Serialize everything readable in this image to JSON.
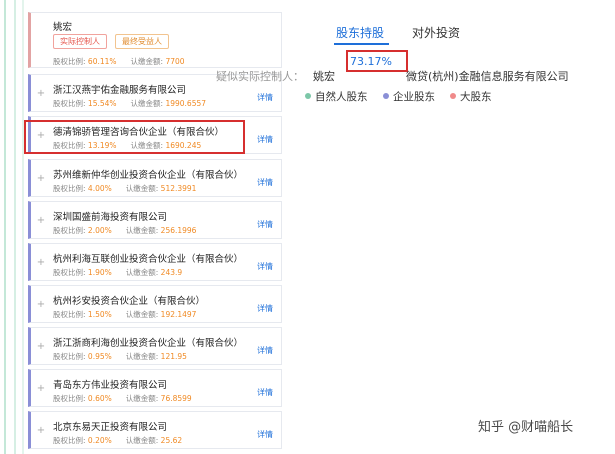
{
  "shareholders": [
    {
      "name": "姚宏",
      "ratio_label": "股权比例:",
      "ratio": "60.11%",
      "amount_label": "认缴金额:",
      "amount": "7700",
      "tags": [
        "实际控制人",
        "最终受益人"
      ],
      "detail": ""
    },
    {
      "name": "浙江汉燕宇佑金融服务有限公司",
      "ratio_label": "股权比例:",
      "ratio": "15.54%",
      "amount_label": "认缴金额:",
      "amount": "1990.6557",
      "detail": "详情"
    },
    {
      "name": "德清锦骄管理咨询合伙企业（有限合伙）",
      "ratio_label": "股权比例:",
      "ratio": "13.19%",
      "amount_label": "认缴金额:",
      "amount": "1690.245",
      "detail": "详情"
    },
    {
      "name": "苏州维新仲华创业投资合伙企业（有限合伙）",
      "ratio_label": "股权比例:",
      "ratio": "4.00%",
      "amount_label": "认缴金额:",
      "amount": "512.3991",
      "detail": "详情"
    },
    {
      "name": "深圳国盛前海投资有限公司",
      "ratio_label": "股权比例:",
      "ratio": "2.00%",
      "amount_label": "认缴金额:",
      "amount": "256.1996",
      "detail": "详情"
    },
    {
      "name": "杭州利海互联创业投资合伙企业（有限合伙）",
      "ratio_label": "股权比例:",
      "ratio": "1.90%",
      "amount_label": "认缴金额:",
      "amount": "243.9",
      "detail": "详情"
    },
    {
      "name": "杭州衫安投资合伙企业（有限合伙）",
      "ratio_label": "股权比例:",
      "ratio": "1.50%",
      "amount_label": "认缴金额:",
      "amount": "192.1497",
      "detail": "详情"
    },
    {
      "name": "浙江浙商利海创业投资合伙企业（有限合伙）",
      "ratio_label": "股权比例:",
      "ratio": "0.95%",
      "amount_label": "认缴金额:",
      "amount": "121.95",
      "detail": "详情"
    },
    {
      "name": "青岛东方伟业投资有限公司",
      "ratio_label": "股权比例:",
      "ratio": "0.60%",
      "amount_label": "认缴金额:",
      "amount": "76.8599",
      "detail": "详情"
    },
    {
      "name": "北京东易天正投资有限公司",
      "ratio_label": "股权比例:",
      "ratio": "0.20%",
      "amount_label": "认缴金额:",
      "amount": "25.62",
      "detail": "详情"
    }
  ],
  "tabs": [
    "股东持股",
    "对外投资"
  ],
  "controller": {
    "label": "疑似实际控制人：",
    "name": "姚宏",
    "percent": "73.17%",
    "company": "微贷(杭州)金融信息服务有限公司"
  },
  "legend": [
    {
      "label": "自然人股东",
      "color": "#7cc7a8"
    },
    {
      "label": "企业股东",
      "color": "#8a8fd6"
    },
    {
      "label": "大股东",
      "color": "#f08a8a"
    }
  ],
  "watermark": "知乎 @财喵船长",
  "colors": {
    "accent": "#1e6fd9",
    "highlight_box": "#d62f2f",
    "value": "#f08a24"
  }
}
